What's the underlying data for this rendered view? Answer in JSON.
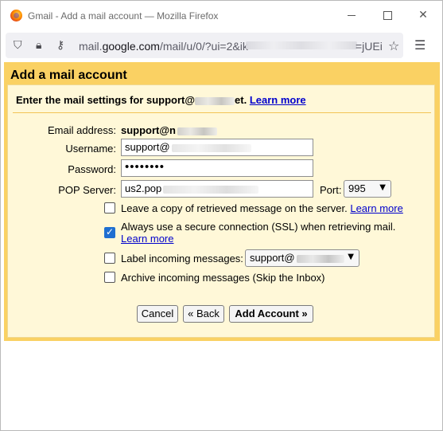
{
  "window": {
    "title": "Gmail - Add a mail account — Mozilla Firefox"
  },
  "urlbar": {
    "url_prefix": "mail.",
    "url_host": "google.com",
    "url_path": "/mail/u/0/?ui=2&ik",
    "url_tail": "=jUEi"
  },
  "dialog": {
    "title": "Add a mail account",
    "subheading_prefix": "Enter the mail settings for support@",
    "subheading_suffix": "et.",
    "learn_more": "Learn more"
  },
  "form": {
    "email_label": "Email address:",
    "email_value": "support@n",
    "username_label": "Username:",
    "username_value": "support@",
    "password_label": "Password:",
    "password_value": "••••••••",
    "pop_label": "POP Server:",
    "pop_value": "us2.pop",
    "port_label": "Port:",
    "port_value": "995"
  },
  "options": {
    "leave_copy": "Leave a copy of retrieved message on the server.",
    "leave_copy_link": "Learn more",
    "leave_copy_checked": false,
    "ssl": "Always use a secure connection (SSL) when retrieving mail.",
    "ssl_link": "Learn more",
    "ssl_checked": true,
    "label_incoming": "Label incoming messages:",
    "label_value": "support@",
    "label_checked": false,
    "archive": "Archive incoming messages (Skip the Inbox)",
    "archive_checked": false
  },
  "buttons": {
    "cancel": "Cancel",
    "back": "« Back",
    "add_account": "Add Account »"
  },
  "colors": {
    "panel": "#fad163",
    "panel_inner": "#fff8d8",
    "link": "#0000cc",
    "checkbox_checked": "#1f6fd1"
  }
}
